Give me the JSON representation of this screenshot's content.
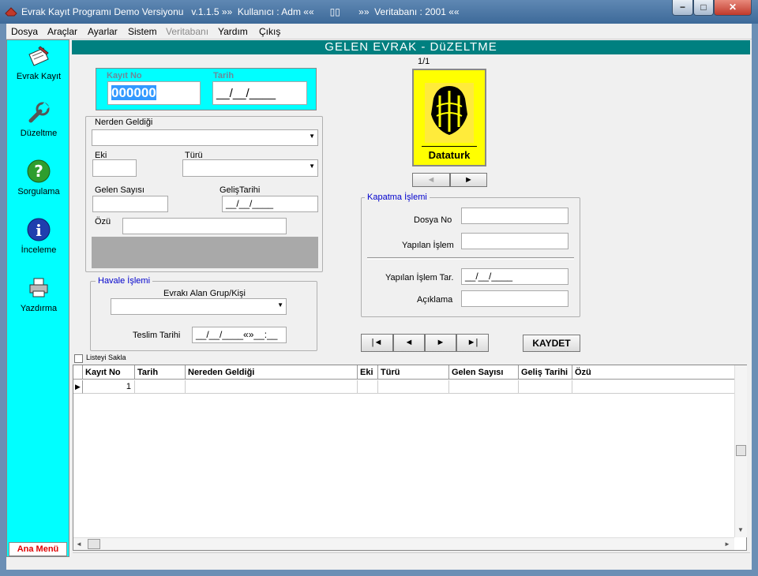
{
  "window": {
    "title": "Evrak Kayıt Programı Demo Versiyonu   v.1.1.5 »»  Kullanıcı : Adm ««      ▯▯       »»  Veritabanı : 2001 ««",
    "minimize": "−",
    "maximize": "□",
    "close": "✕"
  },
  "menu": [
    "Dosya",
    "Araçlar",
    "Ayarlar",
    "Sistem",
    "Veritabanı",
    "Yardım",
    "Çıkış"
  ],
  "sidebar": {
    "items": [
      {
        "label": "Evrak Kayıt",
        "icon": "pen-paper-icon"
      },
      {
        "label": "Düzeltme",
        "icon": "wrench-icon"
      },
      {
        "label": "Sorgulama",
        "icon": "question-icon"
      },
      {
        "label": "İnceleme",
        "icon": "info-icon"
      },
      {
        "label": "Yazdırma",
        "icon": "printer-icon"
      }
    ],
    "ana_menu": "Ana Menü"
  },
  "header": "GELEN EVRAK - DüZELTME",
  "form": {
    "kayit_no_label": "Kayıt No",
    "kayit_no_value": "000000",
    "tarih_label": "Tarih",
    "tarih_value": "__/__/____",
    "nerden_label": "Nerden Geldiği",
    "eki_label": "Eki",
    "turu_label": "Türü",
    "gelen_sayisi_label": "Gelen Sayısı",
    "gelis_tarihi_label": "GelişTarihi",
    "gelis_tarihi_value": "__/__/____",
    "ozu_label": "Özü"
  },
  "havale": {
    "title": "Havale İşlemi",
    "alan_label": "Evrakı Alan Grup/Kişi",
    "teslim_label": "Teslim Tarihi",
    "teslim_value": "__/__/____«»__:__"
  },
  "image_panel": {
    "counter": "1/1",
    "logo_text": "Dataturk",
    "prev": "◄",
    "next": "►"
  },
  "kapatma": {
    "title": "Kapatma İşlemi",
    "dosya_no_label": "Dosya No",
    "yapilan_islem_label": "Yapılan İşlem",
    "yapilan_islem_tar_label": "Yapılan İşlem Tar.",
    "yapilan_islem_tar_value": "__/__/____",
    "aciklama_label": "Açıklama"
  },
  "nav": {
    "first": "|◄",
    "prev": "◄",
    "next": "►",
    "last": "►|",
    "save": "KAYDET"
  },
  "listeyi_sakla": "Listeyi Sakla",
  "grid": {
    "columns": [
      "Kayıt No",
      "Tarih",
      "Nereden Geldiği",
      "Eki",
      "Türü",
      "Gelen Sayısı",
      "Geliş Tarihi",
      "Özü"
    ],
    "rows": [
      [
        "1",
        "",
        "",
        "",
        "",
        "",
        "",
        ""
      ]
    ]
  },
  "colors": {
    "sidebar_bg": "#00ffff",
    "header_bg": "#008080",
    "kayit_panel_bg": "#00ffff",
    "group_title": "#0000cc"
  }
}
